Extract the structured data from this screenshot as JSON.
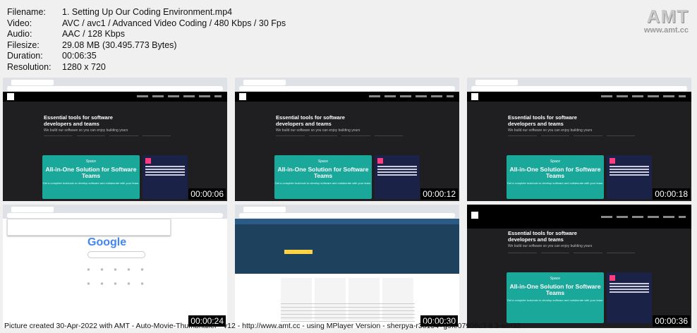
{
  "meta": [
    {
      "key": "Filename:",
      "value": "1. Setting Up Our Coding Environment.mp4"
    },
    {
      "key": "Video:",
      "value": "AVC / avc1 / Advanced Video Coding / 480 Kbps / 30 Fps"
    },
    {
      "key": "Audio:",
      "value": "AAC / 128 Kbps"
    },
    {
      "key": "Filesize:",
      "value": "29.08 MB (30.495.773 Bytes)"
    },
    {
      "key": "Duration:",
      "value": "00:06:35"
    },
    {
      "key": "Resolution:",
      "value": "1280 x 720"
    }
  ],
  "logo": {
    "text": "AMT",
    "url": "www.amt.cc"
  },
  "jb": {
    "headline": "Essential tools for software developers and teams",
    "sub": "We build our software so you can enjoy building yours",
    "space_label": "Space",
    "space_title": "All-in-One Solution for Software Teams",
    "space_sub": "Get a complete toolchain to develop software and collaborate with your team."
  },
  "google": {
    "logo": "Google"
  },
  "timestamps": [
    "00:00:06",
    "00:00:12",
    "00:00:18",
    "00:00:24",
    "00:00:30",
    "00:00:36"
  ],
  "footer": "Picture created 30-Apr-2022 with AMT - Auto-Movie-Thumbnailer - v12 - http://www.amt.cc - using MPlayer Version - sherpya-r38154+g9fe07908c3-8.3-win32"
}
